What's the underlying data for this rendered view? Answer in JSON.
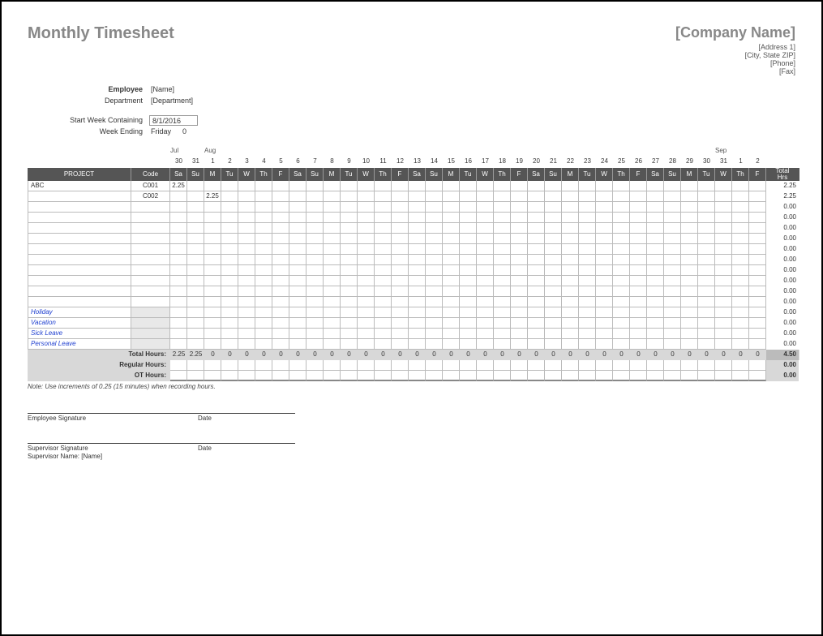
{
  "title": "Monthly Timesheet",
  "company": {
    "name": "[Company Name]",
    "address1": "[Address 1]",
    "address2": "[City, State ZIP]",
    "phone": "[Phone]",
    "fax": "[Fax]"
  },
  "employee": {
    "label": "Employee",
    "value": "[Name]",
    "dept_label": "Department",
    "dept_value": "[Department]"
  },
  "period": {
    "start_label": "Start Week Containing",
    "start_value": "8/1/2016",
    "end_label": "Week Ending",
    "end_value": "Friday",
    "end_extra": "0"
  },
  "months": [
    "Jul",
    "",
    "Aug",
    "",
    "",
    "",
    "",
    "",
    "",
    "",
    "",
    "",
    "",
    "",
    "",
    "",
    "",
    "",
    "",
    "",
    "",
    "",
    "",
    "",
    "",
    "",
    "",
    "",
    "",
    "",
    "",
    "",
    "Sep",
    ""
  ],
  "dates": [
    "30",
    "31",
    "1",
    "2",
    "3",
    "4",
    "5",
    "6",
    "7",
    "8",
    "9",
    "10",
    "11",
    "12",
    "13",
    "14",
    "15",
    "16",
    "17",
    "18",
    "19",
    "20",
    "21",
    "22",
    "23",
    "24",
    "25",
    "26",
    "27",
    "28",
    "29",
    "30",
    "31",
    "1",
    "2"
  ],
  "dows": [
    "Sa",
    "Su",
    "M",
    "Tu",
    "W",
    "Th",
    "F",
    "Sa",
    "Su",
    "M",
    "Tu",
    "W",
    "Th",
    "F",
    "Sa",
    "Su",
    "M",
    "Tu",
    "W",
    "Th",
    "F",
    "Sa",
    "Su",
    "M",
    "Tu",
    "W",
    "Th",
    "F",
    "Sa",
    "Su",
    "M",
    "Tu",
    "W",
    "Th",
    "F"
  ],
  "headers": {
    "project": "PROJECT",
    "code": "Code",
    "total": "Total Hrs"
  },
  "rows": [
    {
      "project": "ABC",
      "code": "C001",
      "cells": [
        "2.25",
        "",
        "",
        "",
        "",
        "",
        "",
        "",
        "",
        "",
        "",
        "",
        "",
        "",
        "",
        "",
        "",
        "",
        "",
        "",
        "",
        "",
        "",
        "",
        "",
        "",
        "",
        "",
        "",
        "",
        "",
        "",
        "",
        "",
        ""
      ],
      "total": "2.25"
    },
    {
      "project": "",
      "code": "C002",
      "cells": [
        "",
        "",
        "2.25",
        "",
        "",
        "",
        "",
        "",
        "",
        "",
        "",
        "",
        "",
        "",
        "",
        "",
        "",
        "",
        "",
        "",
        "",
        "",
        "",
        "",
        "",
        "",
        "",
        "",
        "",
        "",
        "",
        "",
        "",
        "",
        ""
      ],
      "total": "2.25"
    },
    {
      "project": "",
      "code": "",
      "cells": [
        "",
        "",
        "",
        "",
        "",
        "",
        "",
        "",
        "",
        "",
        "",
        "",
        "",
        "",
        "",
        "",
        "",
        "",
        "",
        "",
        "",
        "",
        "",
        "",
        "",
        "",
        "",
        "",
        "",
        "",
        "",
        "",
        "",
        "",
        ""
      ],
      "total": "0.00"
    },
    {
      "project": "",
      "code": "",
      "cells": [
        "",
        "",
        "",
        "",
        "",
        "",
        "",
        "",
        "",
        "",
        "",
        "",
        "",
        "",
        "",
        "",
        "",
        "",
        "",
        "",
        "",
        "",
        "",
        "",
        "",
        "",
        "",
        "",
        "",
        "",
        "",
        "",
        "",
        "",
        ""
      ],
      "total": "0.00"
    },
    {
      "project": "",
      "code": "",
      "cells": [
        "",
        "",
        "",
        "",
        "",
        "",
        "",
        "",
        "",
        "",
        "",
        "",
        "",
        "",
        "",
        "",
        "",
        "",
        "",
        "",
        "",
        "",
        "",
        "",
        "",
        "",
        "",
        "",
        "",
        "",
        "",
        "",
        "",
        "",
        ""
      ],
      "total": "0.00"
    },
    {
      "project": "",
      "code": "",
      "cells": [
        "",
        "",
        "",
        "",
        "",
        "",
        "",
        "",
        "",
        "",
        "",
        "",
        "",
        "",
        "",
        "",
        "",
        "",
        "",
        "",
        "",
        "",
        "",
        "",
        "",
        "",
        "",
        "",
        "",
        "",
        "",
        "",
        "",
        "",
        ""
      ],
      "total": "0.00"
    },
    {
      "project": "",
      "code": "",
      "cells": [
        "",
        "",
        "",
        "",
        "",
        "",
        "",
        "",
        "",
        "",
        "",
        "",
        "",
        "",
        "",
        "",
        "",
        "",
        "",
        "",
        "",
        "",
        "",
        "",
        "",
        "",
        "",
        "",
        "",
        "",
        "",
        "",
        "",
        "",
        ""
      ],
      "total": "0.00"
    },
    {
      "project": "",
      "code": "",
      "cells": [
        "",
        "",
        "",
        "",
        "",
        "",
        "",
        "",
        "",
        "",
        "",
        "",
        "",
        "",
        "",
        "",
        "",
        "",
        "",
        "",
        "",
        "",
        "",
        "",
        "",
        "",
        "",
        "",
        "",
        "",
        "",
        "",
        "",
        "",
        ""
      ],
      "total": "0.00"
    },
    {
      "project": "",
      "code": "",
      "cells": [
        "",
        "",
        "",
        "",
        "",
        "",
        "",
        "",
        "",
        "",
        "",
        "",
        "",
        "",
        "",
        "",
        "",
        "",
        "",
        "",
        "",
        "",
        "",
        "",
        "",
        "",
        "",
        "",
        "",
        "",
        "",
        "",
        "",
        "",
        ""
      ],
      "total": "0.00"
    },
    {
      "project": "",
      "code": "",
      "cells": [
        "",
        "",
        "",
        "",
        "",
        "",
        "",
        "",
        "",
        "",
        "",
        "",
        "",
        "",
        "",
        "",
        "",
        "",
        "",
        "",
        "",
        "",
        "",
        "",
        "",
        "",
        "",
        "",
        "",
        "",
        "",
        "",
        "",
        "",
        ""
      ],
      "total": "0.00"
    },
    {
      "project": "",
      "code": "",
      "cells": [
        "",
        "",
        "",
        "",
        "",
        "",
        "",
        "",
        "",
        "",
        "",
        "",
        "",
        "",
        "",
        "",
        "",
        "",
        "",
        "",
        "",
        "",
        "",
        "",
        "",
        "",
        "",
        "",
        "",
        "",
        "",
        "",
        "",
        "",
        ""
      ],
      "total": "0.00"
    },
    {
      "project": "",
      "code": "",
      "cells": [
        "",
        "",
        "",
        "",
        "",
        "",
        "",
        "",
        "",
        "",
        "",
        "",
        "",
        "",
        "",
        "",
        "",
        "",
        "",
        "",
        "",
        "",
        "",
        "",
        "",
        "",
        "",
        "",
        "",
        "",
        "",
        "",
        "",
        "",
        ""
      ],
      "total": "0.00"
    }
  ],
  "special_rows": [
    {
      "project": "Holiday",
      "cells": [
        "",
        "",
        "",
        "",
        "",
        "",
        "",
        "",
        "",
        "",
        "",
        "",
        "",
        "",
        "",
        "",
        "",
        "",
        "",
        "",
        "",
        "",
        "",
        "",
        "",
        "",
        "",
        "",
        "",
        "",
        "",
        "",
        "",
        "",
        ""
      ],
      "total": "0.00"
    },
    {
      "project": "Vacation",
      "cells": [
        "",
        "",
        "",
        "",
        "",
        "",
        "",
        "",
        "",
        "",
        "",
        "",
        "",
        "",
        "",
        "",
        "",
        "",
        "",
        "",
        "",
        "",
        "",
        "",
        "",
        "",
        "",
        "",
        "",
        "",
        "",
        "",
        "",
        "",
        ""
      ],
      "total": "0.00"
    },
    {
      "project": "Sick Leave",
      "cells": [
        "",
        "",
        "",
        "",
        "",
        "",
        "",
        "",
        "",
        "",
        "",
        "",
        "",
        "",
        "",
        "",
        "",
        "",
        "",
        "",
        "",
        "",
        "",
        "",
        "",
        "",
        "",
        "",
        "",
        "",
        "",
        "",
        "",
        "",
        ""
      ],
      "total": "0.00"
    },
    {
      "project": "Personal Leave",
      "cells": [
        "",
        "",
        "",
        "",
        "",
        "",
        "",
        "",
        "",
        "",
        "",
        "",
        "",
        "",
        "",
        "",
        "",
        "",
        "",
        "",
        "",
        "",
        "",
        "",
        "",
        "",
        "",
        "",
        "",
        "",
        "",
        "",
        "",
        "",
        ""
      ],
      "total": "0.00"
    }
  ],
  "totals": {
    "label": "Total Hours:",
    "cells": [
      "2.25",
      "2.25",
      "0",
      "0",
      "0",
      "0",
      "0",
      "0",
      "0",
      "0",
      "0",
      "0",
      "0",
      "0",
      "0",
      "0",
      "0",
      "0",
      "0",
      "0",
      "0",
      "0",
      "0",
      "0",
      "0",
      "0",
      "0",
      "0",
      "0",
      "0",
      "0",
      "0",
      "0",
      "0",
      "0"
    ],
    "grand": "4.50"
  },
  "regular": {
    "label": "Regular Hours:",
    "cells": [
      "",
      "",
      "",
      "",
      "",
      "",
      "",
      "",
      "",
      "",
      "",
      "",
      "",
      "",
      "",
      "",
      "",
      "",
      "",
      "",
      "",
      "",
      "",
      "",
      "",
      "",
      "",
      "",
      "",
      "",
      "",
      "",
      "",
      "",
      ""
    ],
    "grand": "0.00"
  },
  "ot": {
    "label": "OT Hours:",
    "cells": [
      "",
      "",
      "",
      "",
      "",
      "",
      "",
      "",
      "",
      "",
      "",
      "",
      "",
      "",
      "",
      "",
      "",
      "",
      "",
      "",
      "",
      "",
      "",
      "",
      "",
      "",
      "",
      "",
      "",
      "",
      "",
      "",
      "",
      "",
      ""
    ],
    "grand": "0.00"
  },
  "note": "Note: Use increments of 0.25 (15 minutes) when recording hours.",
  "sig": {
    "emp": "Employee Signature",
    "date": "Date",
    "sup": "Supervisor Signature",
    "sup_name_label": "Supervisor Name:",
    "sup_name_value": "[Name]"
  }
}
